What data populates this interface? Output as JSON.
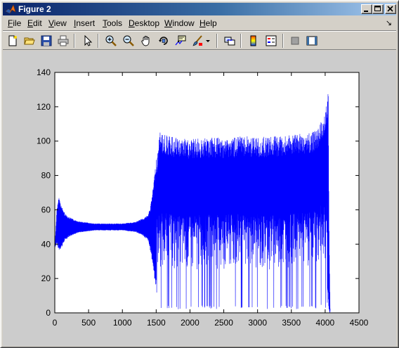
{
  "window": {
    "title": "Figure 2"
  },
  "menu": {
    "file": {
      "accel": "F",
      "rest": "ile"
    },
    "edit": {
      "accel": "E",
      "rest": "dit"
    },
    "view": {
      "accel": "V",
      "rest": "iew"
    },
    "insert": {
      "accel": "I",
      "rest": "nsert"
    },
    "tools": {
      "accel": "T",
      "rest": "ools"
    },
    "desktop": {
      "accel": "D",
      "rest": "esktop"
    },
    "window": {
      "accel": "W",
      "rest": "indow"
    },
    "help": {
      "accel": "H",
      "rest": "elp"
    },
    "dock_arrow": "↘"
  },
  "toolbar": {
    "icons": [
      "new-figure-icon",
      "open-file-icon",
      "save-icon",
      "print-icon",
      "select-arrow-icon",
      "zoom-in-icon",
      "zoom-out-icon",
      "pan-hand-icon",
      "rotate-3d-icon",
      "data-cursor-icon",
      "brush-icon",
      "brush-dropdown-icon",
      "link-plot-icon",
      "colorbar-icon",
      "legend-icon",
      "hide-plot-tools-icon",
      "show-plot-tools-icon"
    ]
  },
  "colors": {
    "line": "#0000ff",
    "axes_bg": "#ffffff",
    "figure_bg": "#cccccc",
    "title_start": "#0a246a",
    "title_end": "#a6caf0"
  },
  "chart_data": {
    "type": "line",
    "title": "",
    "xlabel": "",
    "ylabel": "",
    "xlim": [
      0,
      4500
    ],
    "ylim": [
      0,
      140
    ],
    "xticks": [
      0,
      500,
      1000,
      1500,
      2000,
      2500,
      3000,
      3500,
      4000,
      4500
    ],
    "yticks": [
      0,
      20,
      40,
      60,
      80,
      100,
      120,
      140
    ],
    "grid": false,
    "legend": "none",
    "series": [
      {
        "color": "#0000ff",
        "description_note": "",
        "upper_envelope": {
          "x": [
            0,
            30,
            60,
            100,
            150,
            200,
            300,
            400,
            600,
            800,
            1000,
            1200,
            1300,
            1380,
            1420,
            1460,
            1500,
            1540,
            1560,
            1580,
            1600,
            1700,
            1800,
            2000,
            2200,
            2400,
            2600,
            2800,
            3000,
            3200,
            3400,
            3600,
            3800,
            3900,
            3950,
            4000,
            4030,
            4045,
            4060,
            4075
          ],
          "y": [
            38,
            60,
            68,
            62,
            58,
            56,
            54,
            53,
            52,
            52,
            52,
            53,
            55,
            57,
            63,
            75,
            90,
            100,
            108,
            105,
            104,
            103,
            102,
            101,
            102,
            102,
            102,
            103,
            102,
            103,
            103,
            104,
            105,
            108,
            112,
            118,
            124,
            135,
            40,
            0
          ]
        },
        "lower_envelope": {
          "x": [
            0,
            30,
            60,
            100,
            150,
            200,
            300,
            400,
            600,
            800,
            1000,
            1200,
            1300,
            1380,
            1420,
            1460,
            1500,
            1540,
            1560,
            1600,
            1800,
            2000,
            2200,
            2400,
            2600,
            2800,
            3000,
            3200,
            3400,
            3600,
            3800,
            3900,
            3950,
            4000,
            4030,
            4045,
            4060,
            4075
          ],
          "y": [
            38,
            40,
            36,
            38,
            42,
            44,
            46,
            47,
            48,
            48,
            48,
            47,
            45,
            42,
            35,
            25,
            12,
            5,
            2,
            3,
            2,
            2,
            3,
            2,
            3,
            2,
            3,
            2,
            3,
            2,
            3,
            2,
            5,
            3,
            2,
            1,
            0,
            0
          ]
        },
        "n_points": 4075
      }
    ]
  }
}
